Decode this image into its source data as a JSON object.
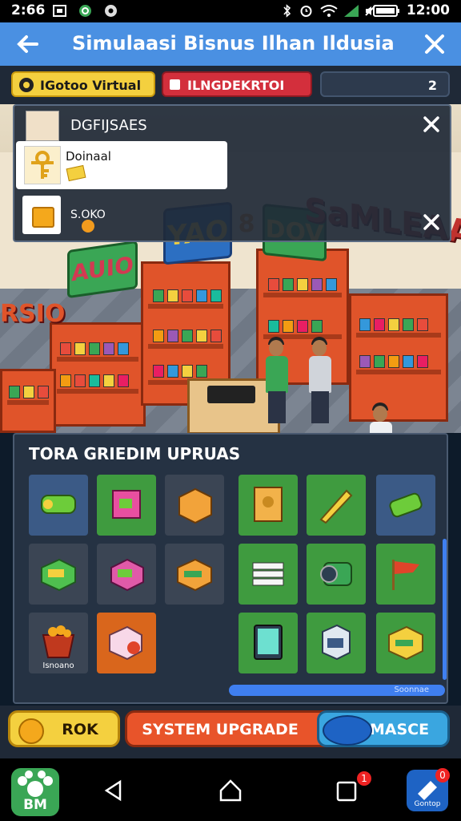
{
  "status_bar": {
    "time": "2:66",
    "clock": "12:00"
  },
  "app_bar": {
    "title": "Simulaasi Bisnus  Ilhan Ildusia"
  },
  "chips": {
    "virtual": "IGotoo Virtual",
    "red": "ILNGDEKRTOI",
    "count": "2"
  },
  "scene_signs": {
    "auio": "AUIO",
    "yao": "YAO",
    "n8": "8",
    "dov": "DOV",
    "samlea": "SaMLEAA",
    "isio": "RSIO"
  },
  "popup": {
    "title": "DGFIJSAES",
    "card_label": "Doinaal",
    "row2_label": "S.OKO"
  },
  "panel": {
    "title": "TORA GRIEDIM UPRUAS",
    "tiles": [
      {
        "icon": "green-tube-icon",
        "color": "blue",
        "caption": ""
      },
      {
        "icon": "pink-box-icon",
        "color": "green",
        "caption": ""
      },
      {
        "icon": "orange-crate-icon",
        "color": "grey",
        "caption": ""
      },
      {
        "icon": "cardboard-box-icon",
        "color": "green",
        "caption": ""
      },
      {
        "icon": "pencil-icon",
        "color": "green",
        "caption": ""
      },
      {
        "icon": "green-can-icon",
        "color": "blue",
        "caption": ""
      },
      {
        "icon": "green-crate-icon",
        "color": "grey",
        "caption": ""
      },
      {
        "icon": "gift-box-icon",
        "color": "grey",
        "caption": ""
      },
      {
        "icon": "orange-box-icon",
        "color": "grey",
        "caption": ""
      },
      {
        "icon": "paper-stack-icon",
        "color": "green",
        "caption": ""
      },
      {
        "icon": "camera-lens-icon",
        "color": "green",
        "caption": ""
      },
      {
        "icon": "flag-icon",
        "color": "green",
        "caption": ""
      },
      {
        "icon": "food-bowl-icon",
        "color": "grey",
        "caption": "Isnoano"
      },
      {
        "icon": "snack-box-icon",
        "color": "orange",
        "caption": ""
      },
      {
        "icon": "tablet-icon",
        "color": "green",
        "caption": ""
      },
      {
        "icon": "juice-box-icon",
        "color": "green",
        "caption": ""
      },
      {
        "icon": "yellow-box-icon",
        "color": "green",
        "caption": ""
      }
    ],
    "hbar_label": "Soonnae"
  },
  "buttons": {
    "ok": "ROK",
    "upgrade": "SYSTEM UPGRADE",
    "masce": "MASCE"
  },
  "navbar": {
    "logo": "BM",
    "square_badge": "1",
    "app_label": "Gontop",
    "app_badge": "0"
  }
}
